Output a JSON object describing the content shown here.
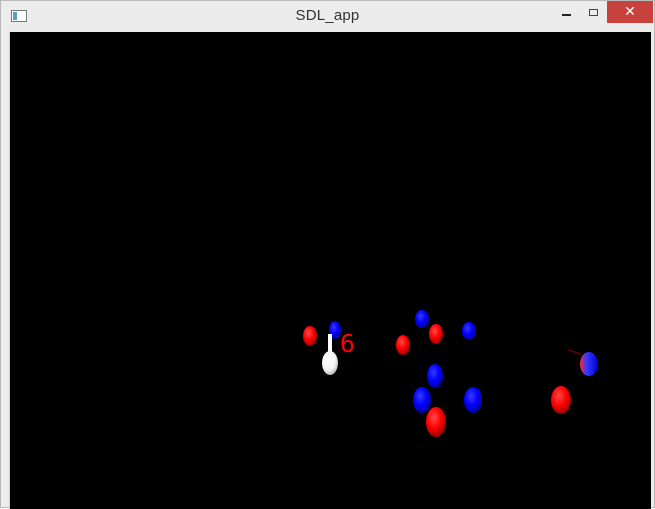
{
  "window": {
    "title": "SDL_app",
    "icon": "app-window-icon",
    "controls": {
      "minimize_icon": "minimize-icon",
      "maximize_icon": "maximize-icon",
      "close_icon": "close-icon",
      "close_label": "✕"
    }
  },
  "scene": {
    "background": "#000000",
    "counter_text": "6",
    "counter_color": "#ff0000",
    "colors": {
      "red": "#ff0000",
      "blue": "#0000ff",
      "white": "#ffffff"
    }
  }
}
